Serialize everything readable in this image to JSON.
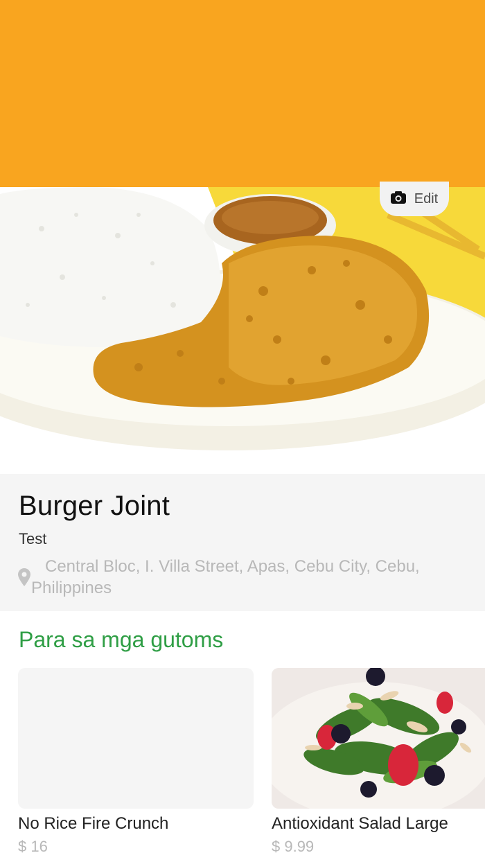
{
  "header": {
    "background_color": "#F9A51F"
  },
  "hero": {
    "image_name": "fried-chicken-with-rice-photo",
    "edit_icon": "camera-icon",
    "edit_label": "Edit"
  },
  "restaurant": {
    "name": "Burger Joint",
    "description": "Test",
    "location_icon": "location-pin-icon",
    "address": "Central Bloc, I. Villa Street, Apas, Cebu City, Cebu, Philippines"
  },
  "menu_section": {
    "title": "Para sa mga gutoms",
    "accent_color": "#2F9E45",
    "items": [
      {
        "name": "No Rice Fire Crunch",
        "price": "$ 16",
        "image": "placeholder"
      },
      {
        "name": "Antioxidant Salad Large",
        "price": "$ 9.99",
        "image": "spinach-berry-salad-photo"
      }
    ]
  }
}
